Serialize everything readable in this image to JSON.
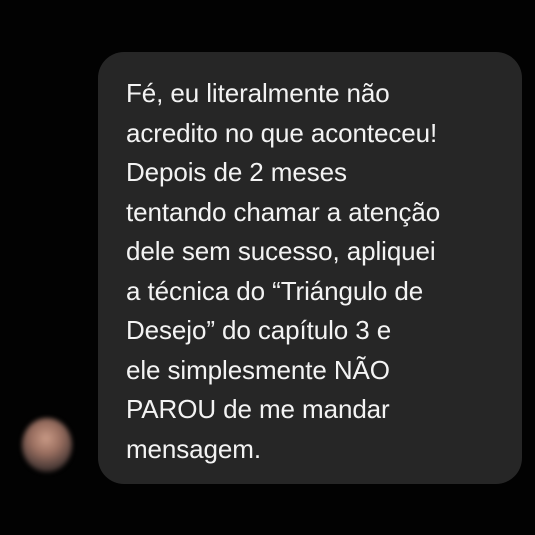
{
  "colors": {
    "background": "#020202",
    "bubble": "#262626",
    "text": "#f3f3f3"
  },
  "avatar": {
    "icon": "blurred-profile-photo"
  },
  "message": {
    "lines": [
      "Fé, eu literalmente não",
      "acredito no que aconteceu!",
      "Depois de 2 meses",
      "tentando chamar a atenção",
      "dele sem sucesso, apliquei",
      "a técnica do “Triángulo de",
      "Desejo” do capítulo 3 e",
      "ele simplesmente NÃO",
      "PAROU de me mandar",
      "mensagem."
    ]
  }
}
